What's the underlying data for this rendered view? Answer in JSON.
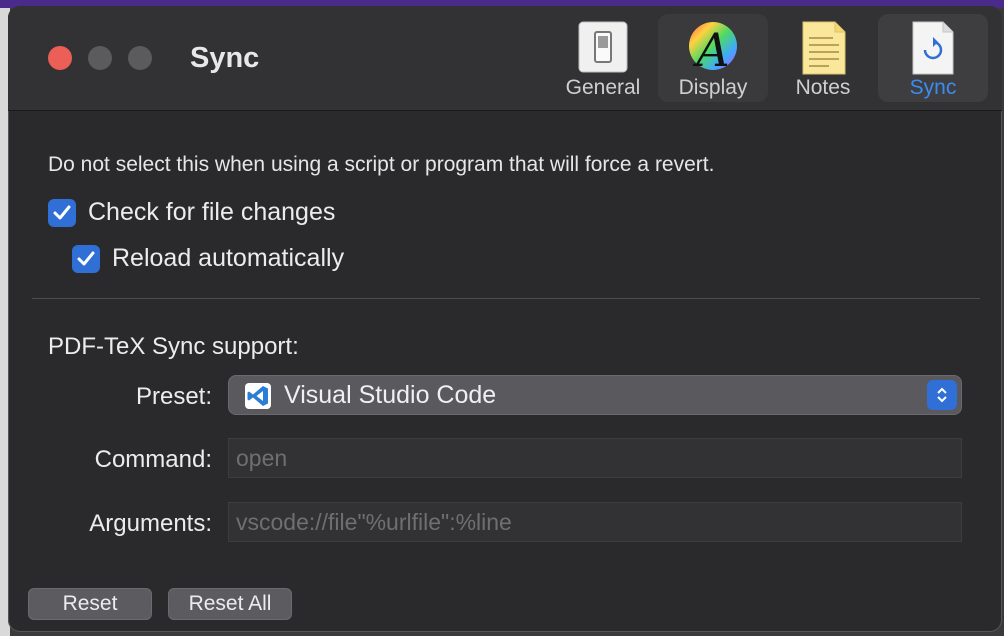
{
  "window": {
    "title": "Sync"
  },
  "toolbar": {
    "tabs": [
      {
        "label": "General",
        "icon": "switch-icon",
        "selected": false
      },
      {
        "label": "Display",
        "icon": "display-font-icon",
        "selected": false
      },
      {
        "label": "Notes",
        "icon": "notes-icon",
        "selected": false
      },
      {
        "label": "Sync",
        "icon": "sync-document-icon",
        "selected": true
      }
    ]
  },
  "sync": {
    "hint": "Do not select this when using a script or program that will force a revert.",
    "check_file_changes": {
      "label": "Check for file changes",
      "checked": true
    },
    "reload_automatically": {
      "label": "Reload automatically",
      "checked": true
    },
    "pdftex_heading": "PDF-TeX Sync support:",
    "preset": {
      "label": "Preset:",
      "value": "Visual Studio Code"
    },
    "command": {
      "label": "Command:",
      "placeholder": "open"
    },
    "arguments": {
      "label": "Arguments:",
      "placeholder": "vscode://file\"%urlfile\":%line"
    }
  },
  "buttons": {
    "reset": "Reset",
    "reset_all": "Reset All"
  },
  "colors": {
    "accent": "#2f6fd6",
    "selected_tab_text": "#3b8cf0",
    "close": "#ec5f57"
  }
}
